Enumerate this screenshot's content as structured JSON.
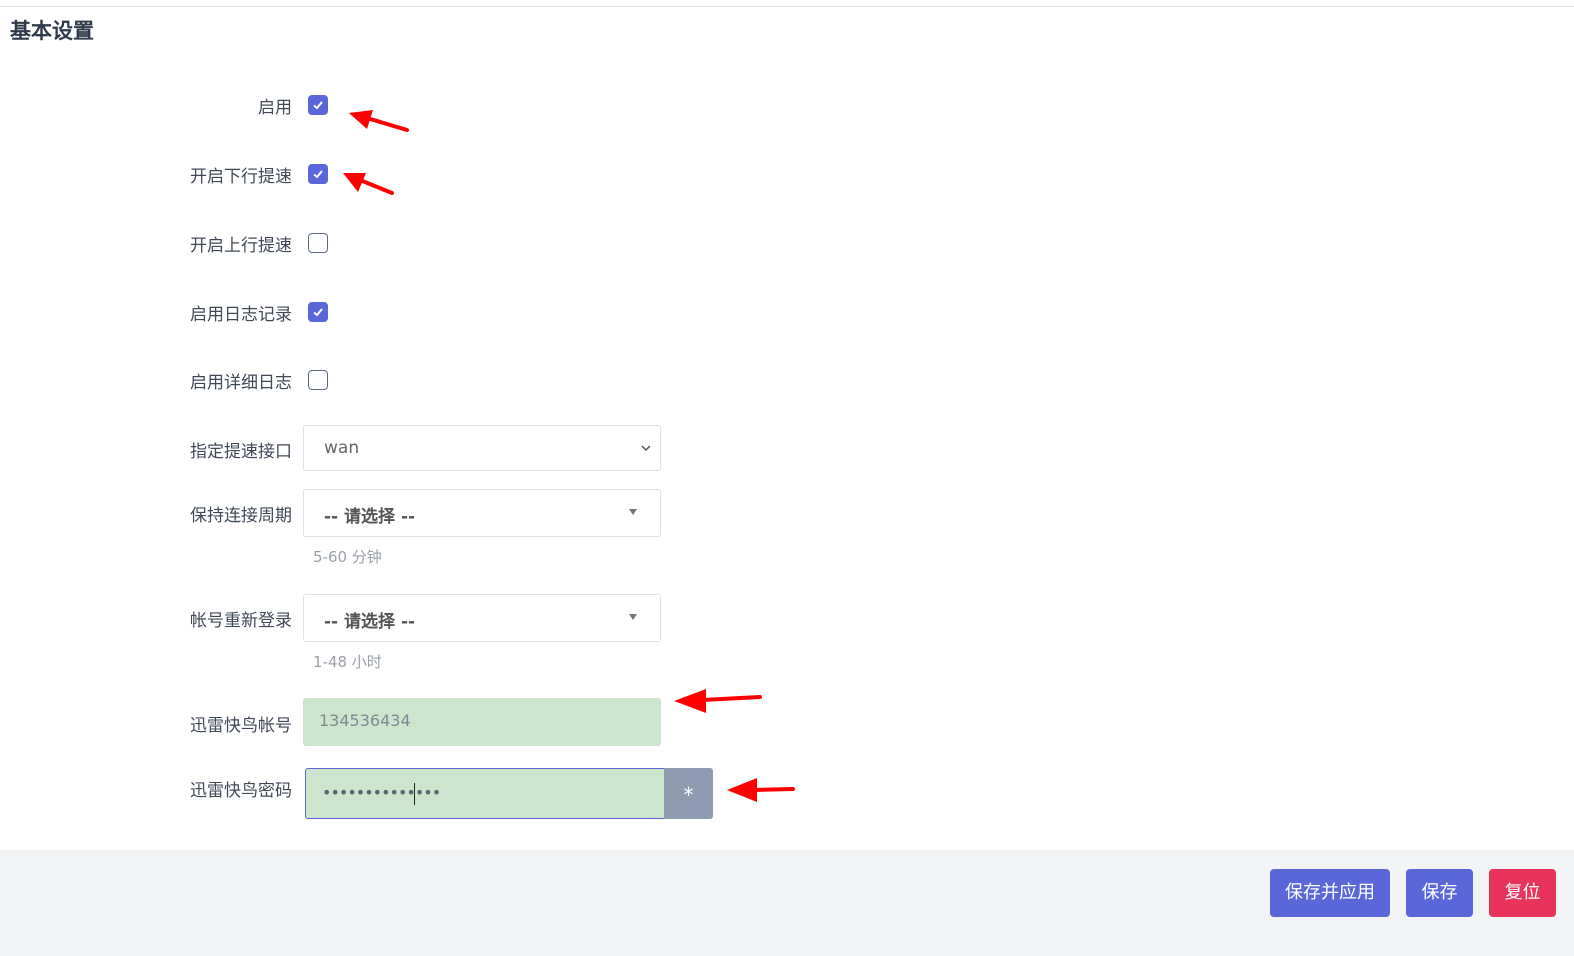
{
  "section": {
    "title": "基本设置"
  },
  "fields": {
    "enable": {
      "label": "启用",
      "checked": true
    },
    "down_boost": {
      "label": "开启下行提速",
      "checked": true
    },
    "up_boost": {
      "label": "开启上行提速",
      "checked": false
    },
    "log": {
      "label": "启用日志记录",
      "checked": true
    },
    "verbose_log": {
      "label": "启用详细日志",
      "checked": false
    },
    "interface": {
      "label": "指定提速接口",
      "value": "wan"
    },
    "keepalive": {
      "label": "保持连接周期",
      "value": "-- 请选择 --",
      "hint": "5-60 分钟"
    },
    "relogin": {
      "label": "帐号重新登录",
      "value": "-- 请选择 --",
      "hint": "1-48 小时"
    },
    "account": {
      "label": "迅雷快鸟帐号",
      "value": "134536434"
    },
    "password": {
      "label": "迅雷快鸟密码",
      "value": "••••••••••••••",
      "toggle": "*"
    }
  },
  "buttons": {
    "save_apply": "保存并应用",
    "save": "保存",
    "reset": "复位"
  },
  "colors": {
    "accent": "#5a67d8",
    "danger": "#e8335a",
    "filled_input": "#cbe6cd",
    "annotation_arrow": "#ff0000"
  }
}
